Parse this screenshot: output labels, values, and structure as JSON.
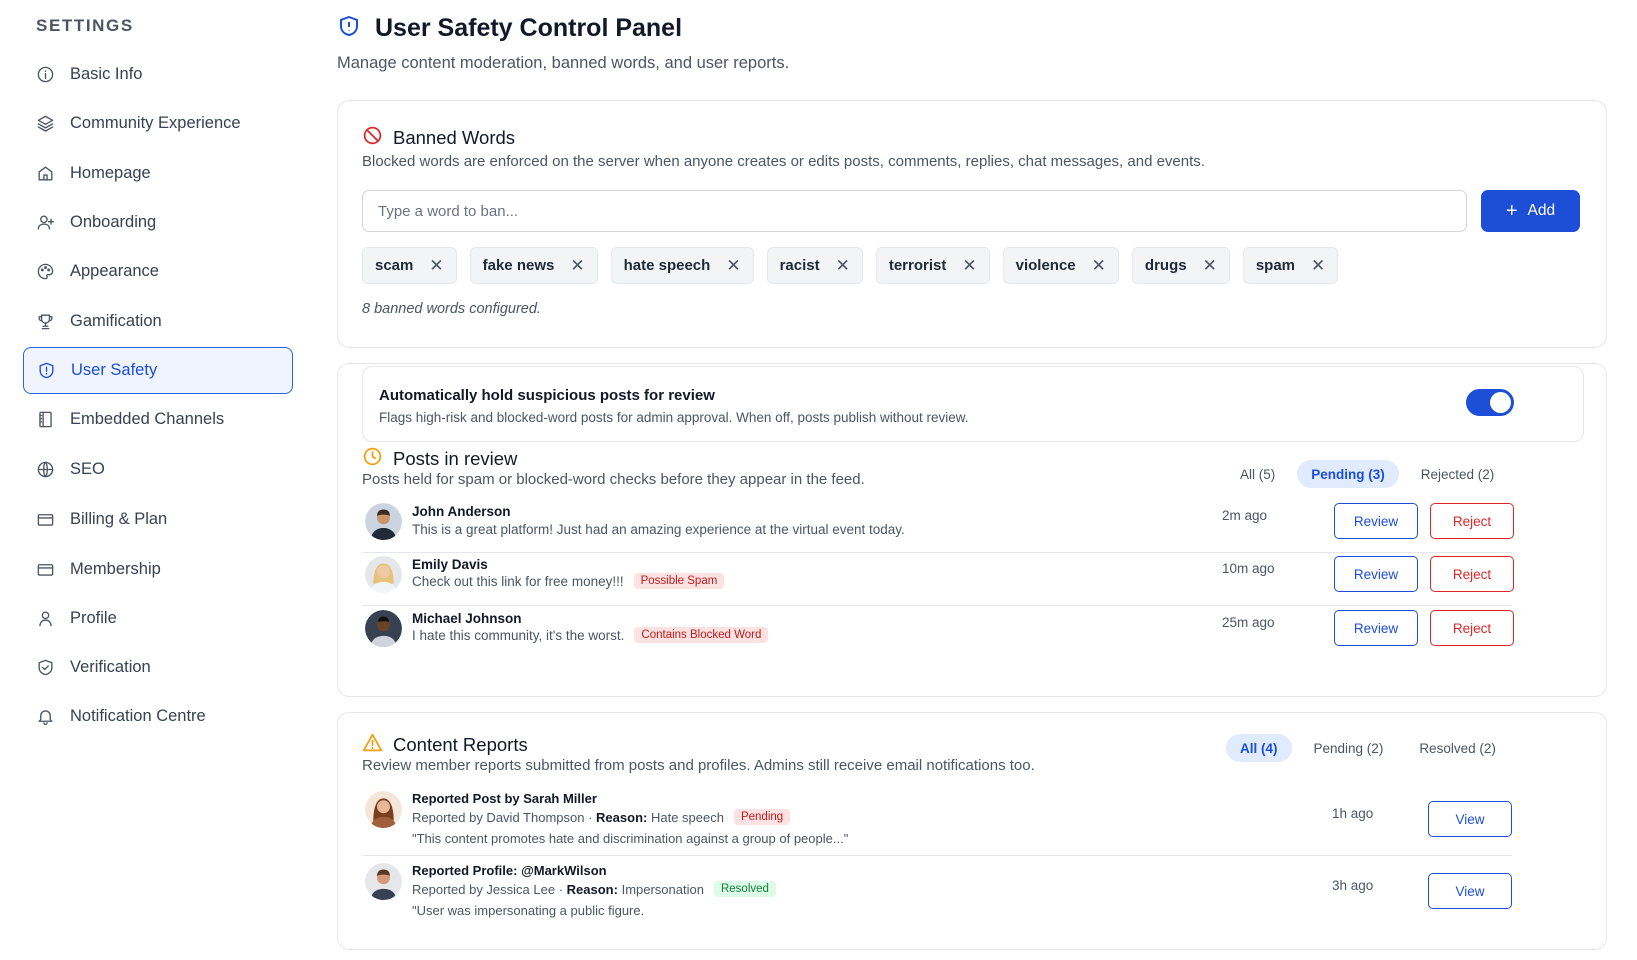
{
  "sidebar": {
    "heading": "SETTINGS",
    "items": [
      {
        "label": "Basic Info",
        "icon": "info-icon"
      },
      {
        "label": "Community Experience",
        "icon": "layers-icon"
      },
      {
        "label": "Homepage",
        "icon": "home-icon"
      },
      {
        "label": "Onboarding",
        "icon": "user-plus-icon"
      },
      {
        "label": "Appearance",
        "icon": "palette-icon"
      },
      {
        "label": "Gamification",
        "icon": "trophy-icon"
      },
      {
        "label": "User Safety",
        "icon": "shield-icon",
        "active": true
      },
      {
        "label": "Embedded Channels",
        "icon": "book-icon"
      },
      {
        "label": "SEO",
        "icon": "globe-icon"
      },
      {
        "label": "Billing & Plan",
        "icon": "card-icon"
      },
      {
        "label": "Membership",
        "icon": "card-icon"
      },
      {
        "label": "Profile",
        "icon": "user-icon"
      },
      {
        "label": "Verification",
        "icon": "shield-check-icon"
      },
      {
        "label": "Notification Centre",
        "icon": "bell-icon"
      }
    ]
  },
  "header": {
    "title": "User Safety Control Panel",
    "subtitle": "Manage content moderation, banned words, and user reports."
  },
  "banned_words": {
    "title": "Banned Words",
    "description": "Blocked words are enforced on the server when anyone creates or edits posts, comments, replies, chat messages, and events.",
    "input_placeholder": "Type a word to ban...",
    "add_label": "Add",
    "words": [
      "scam",
      "fake news",
      "hate speech",
      "racist",
      "terrorist",
      "violence",
      "drugs",
      "spam"
    ],
    "count_text": "8 banned words configured."
  },
  "auto_hold": {
    "title": "Automatically hold suspicious posts for review",
    "description": "Flags high-risk and blocked-word posts for admin approval. When off, posts publish without review.",
    "enabled": true
  },
  "review": {
    "title": "Posts in review",
    "description": "Posts held for spam or blocked-word checks before they appear in the feed.",
    "filters": [
      {
        "label": "All (5)",
        "active": false
      },
      {
        "label": "Pending (3)",
        "active": true
      },
      {
        "label": "Rejected (2)",
        "active": false
      }
    ],
    "review_label": "Review",
    "reject_label": "Reject",
    "posts": [
      {
        "name": "John Anderson",
        "text": "This is a great platform! Just had an amazing experience at the virtual event today.",
        "badge": "",
        "time": "2m ago"
      },
      {
        "name": "Emily Davis",
        "text": "Check out this link for free money!!!",
        "badge": "Possible Spam",
        "time": "10m ago"
      },
      {
        "name": "Michael Johnson",
        "text": "I hate this community, it's the worst.",
        "badge": "Contains Blocked Word",
        "time": "25m ago"
      }
    ]
  },
  "reports": {
    "title": "Content Reports",
    "description": "Review member reports submitted from posts and profiles. Admins still receive email notifications too.",
    "filters": [
      {
        "label": "All (4)",
        "active": true
      },
      {
        "label": "Pending (2)",
        "active": false
      },
      {
        "label": "Resolved (2)",
        "active": false
      }
    ],
    "view_label": "View",
    "reason_label": "Reason:",
    "items": [
      {
        "title": "Reported Post by Sarah Miller",
        "reporter": "Reported by David Thompson ·",
        "reason": "Hate speech",
        "status": "Pending",
        "quote": "\"This content promotes hate and discrimination against a group of people...\"",
        "time": "1h ago"
      },
      {
        "title": "Reported Profile: @MarkWilson",
        "reporter": "Reported by Jessica Lee ·",
        "reason": "Impersonation",
        "status": "Resolved",
        "quote": "\"User was impersonating a public figure.",
        "time": "3h ago"
      }
    ]
  },
  "colors": {
    "accent": "#1d4ed8",
    "danger": "#dc2626",
    "warning": "#f59e0b",
    "success": "#15803d"
  }
}
